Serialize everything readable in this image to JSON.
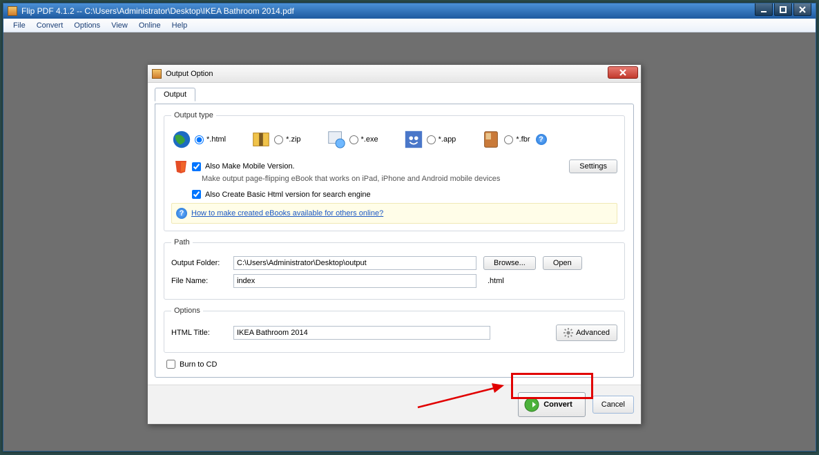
{
  "app": {
    "title": "Flip PDF 4.1.2  -- C:\\Users\\Administrator\\Desktop\\IKEA Bathroom 2014.pdf"
  },
  "menu": {
    "file": "File",
    "convert": "Convert",
    "options": "Options",
    "view": "View",
    "online": "Online",
    "help": "Help"
  },
  "dialog": {
    "title": "Output Option",
    "tab": "Output",
    "output_type_legend": "Output type",
    "types": {
      "html": "*.html",
      "zip": "*.zip",
      "exe": "*.exe",
      "app": "*.app",
      "fbr": "*.fbr"
    },
    "also_mobile": "Also Make Mobile Version.",
    "mobile_sub": "Make output page-flipping eBook that works on iPad, iPhone and Android mobile devices",
    "also_basic": "Also Create Basic Html version for search engine",
    "howto": "How to make created eBooks available for others online?",
    "settings": "Settings",
    "path_legend": "Path",
    "output_folder_label": "Output Folder:",
    "output_folder_value": "C:\\Users\\Administrator\\Desktop\\output",
    "browse": "Browse...",
    "open": "Open",
    "filename_label": "File Name:",
    "filename_value": "index",
    "filename_ext": ".html",
    "options_legend": "Options",
    "html_title_label": "HTML Title:",
    "html_title_value": "IKEA Bathroom 2014",
    "advanced": "Advanced",
    "burn": "Burn to CD",
    "convert": "Convert",
    "cancel": "Cancel"
  }
}
